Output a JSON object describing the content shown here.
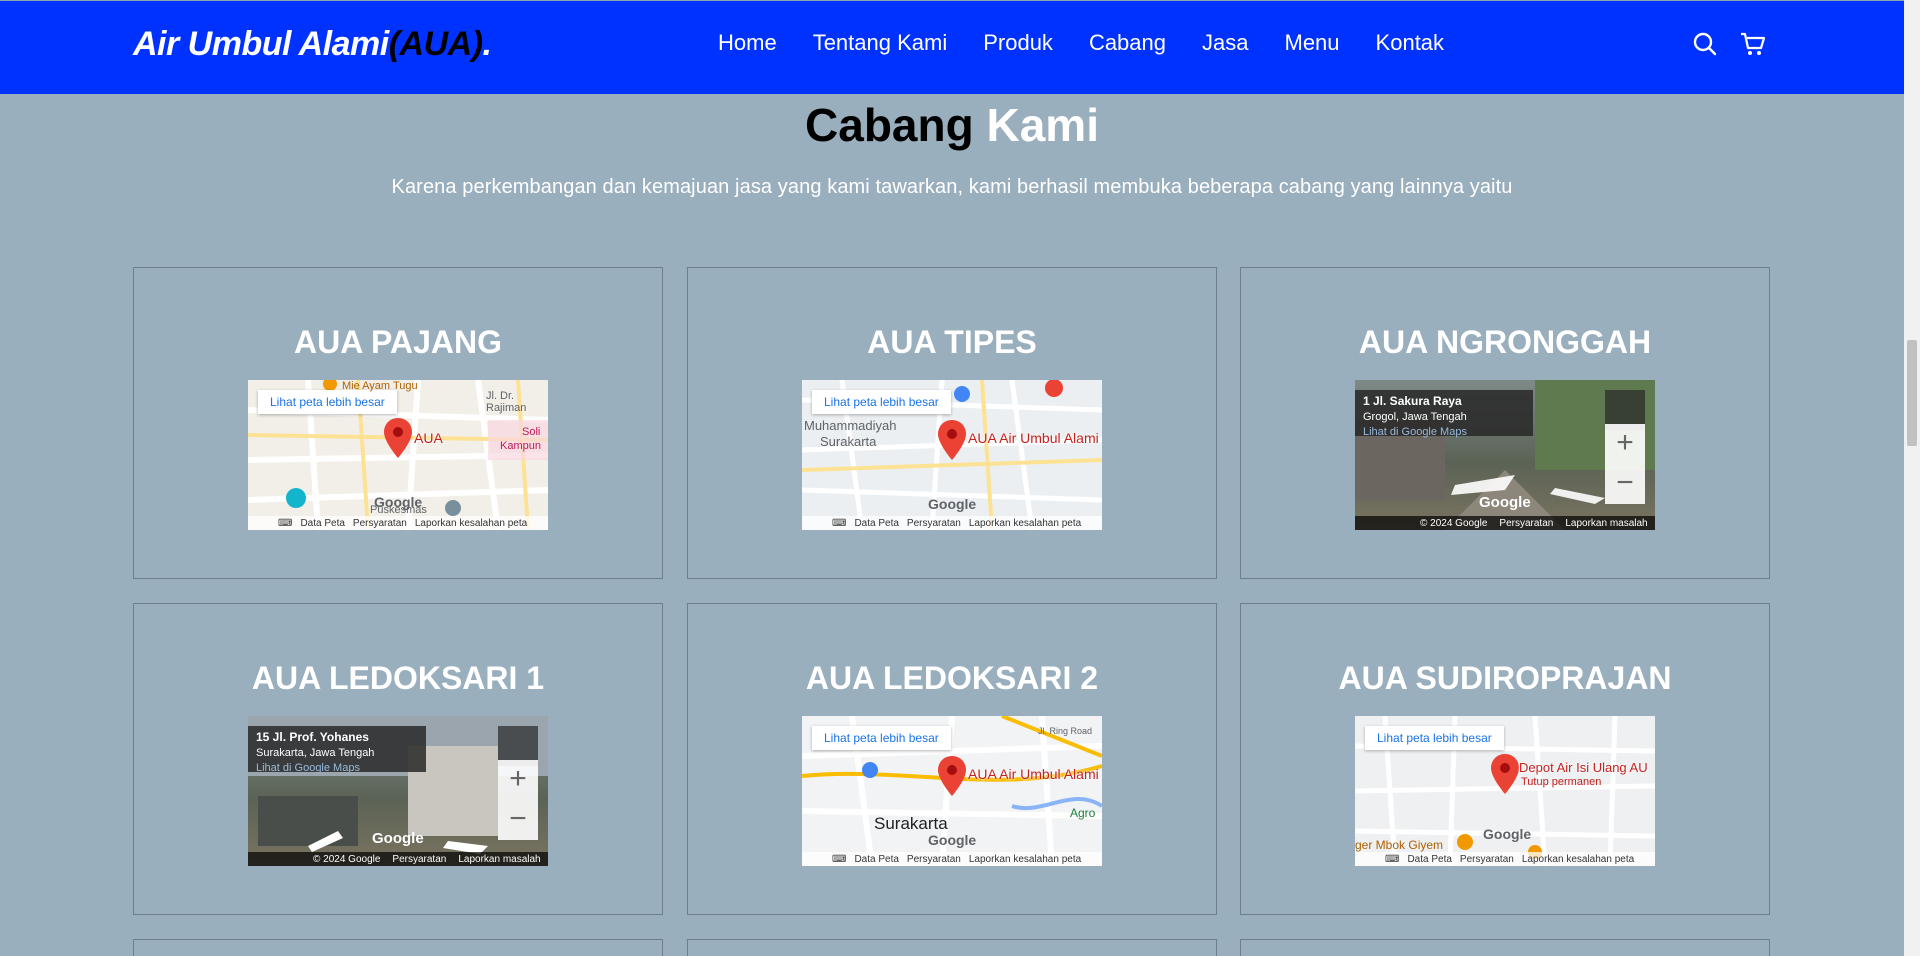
{
  "brand": {
    "main": "Air Umbul Alami",
    "accent": "(AUA)",
    "dot": "."
  },
  "nav": [
    "Home",
    "Tentang Kami",
    "Produk",
    "Cabang",
    "Jasa",
    "Menu",
    "Kontak"
  ],
  "icons": {
    "search": "search-icon",
    "cart": "cart-icon"
  },
  "section": {
    "title_dark": "Cabang",
    "title_light": "Kami",
    "subtitle": "Karena perkembangan dan kemajuan jasa yang kami tawarkan, kami berhasil membuka beberapa cabang yang lainnya yaitu"
  },
  "branches": [
    {
      "name": "AUA PAJANG",
      "map": {
        "type": "map",
        "link": "Lihat peta lebih besar",
        "place": "AUA",
        "extra_labels": [
          "Mie Ayam Tugu",
          "Soli",
          "Kampun",
          "Puskesmas",
          "Jl. Dr. Rajiman"
        ],
        "footer": [
          "Data Peta",
          "Persyaratan",
          "Laporkan kesalahan peta"
        ],
        "logo": "Google"
      }
    },
    {
      "name": "AUA TIPES",
      "map": {
        "type": "map",
        "link": "Lihat peta lebih besar",
        "place": "AUA Air Umbul Alami",
        "extra_labels": [
          "Muhammadiyah",
          "Surakarta"
        ],
        "footer": [
          "Data Peta",
          "Persyaratan",
          "Laporkan kesalahan peta"
        ],
        "logo": "Google"
      }
    },
    {
      "name": "AUA NGRONGGAH",
      "map": {
        "type": "streetview",
        "address": "1 Jl. Sakura Raya",
        "area": "Grogol, Jawa Tengah",
        "link": "Lihat di Google Maps",
        "footer": [
          "© 2024 Google",
          "Persyaratan",
          "Laporkan masalah"
        ],
        "logo": "Google"
      }
    },
    {
      "name": "AUA LEDOKSARI 1",
      "map": {
        "type": "streetview",
        "address": "15 Jl. Prof. Yohanes",
        "area": "Surakarta, Jawa Tengah",
        "link": "Lihat di Google Maps",
        "footer": [
          "© 2024 Google",
          "Persyaratan",
          "Laporkan masalah"
        ],
        "logo": "Google"
      }
    },
    {
      "name": "AUA LEDOKSARI 2",
      "map": {
        "type": "map",
        "link": "Lihat peta lebih besar",
        "place": "AUA Air Umbul Alami",
        "extra_labels": [
          "Surakarta",
          "Agro",
          "Jl. Ring Road"
        ],
        "footer": [
          "Data Peta",
          "Persyaratan",
          "Laporkan kesalahan peta"
        ],
        "logo": "Google"
      }
    },
    {
      "name": "AUA SUDIROPRAJAN",
      "map": {
        "type": "map",
        "link": "Lihat peta lebih besar",
        "place": "Depot Air Isi Ulang AU",
        "place_sub": "Tutup permanen",
        "extra_labels": [
          "ger Mbok Giyem"
        ],
        "footer": [
          "Data Peta",
          "Persyaratan",
          "Laporkan kesalahan peta"
        ],
        "logo": "Google"
      }
    }
  ],
  "colors": {
    "navbar": "#0032ff",
    "page_bg": "#9aafbd",
    "pin": "#ea4335"
  }
}
